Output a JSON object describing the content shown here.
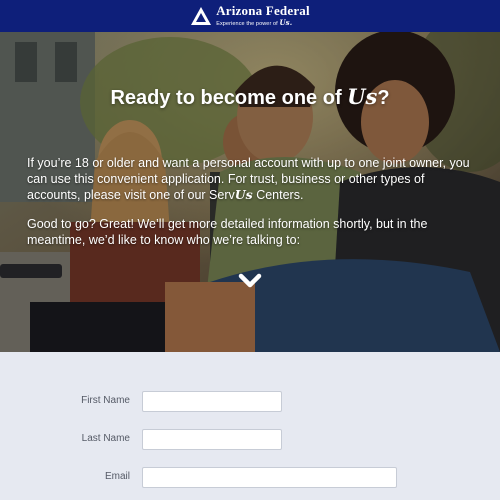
{
  "brand": {
    "name": "Arizona Federal",
    "tagline": "Experience the power of",
    "tagline_us": "Us.",
    "bar_color": "#0e1f7a"
  },
  "hero": {
    "title_before": "Ready to become one of ",
    "title_us": "Us",
    "title_after": "?",
    "paragraph1_before": "If you’re 18 or older and want a personal account with up to one joint owner, you can use this convenient application. For trust, business or other types of accounts, please visit one of our Serv",
    "paragraph1_us": "Us",
    "paragraph1_after": " Centers.",
    "paragraph2": "Good to go? Great! We’ll get more detailed information shortly, but in the meantime, we’d like to know who we’re talking to:",
    "scroll_icon": "chevron-down-icon"
  },
  "form": {
    "first_name_label": "First Name",
    "first_name_value": "",
    "last_name_label": "Last Name",
    "last_name_value": "",
    "email_label": "Email",
    "email_value": ""
  }
}
